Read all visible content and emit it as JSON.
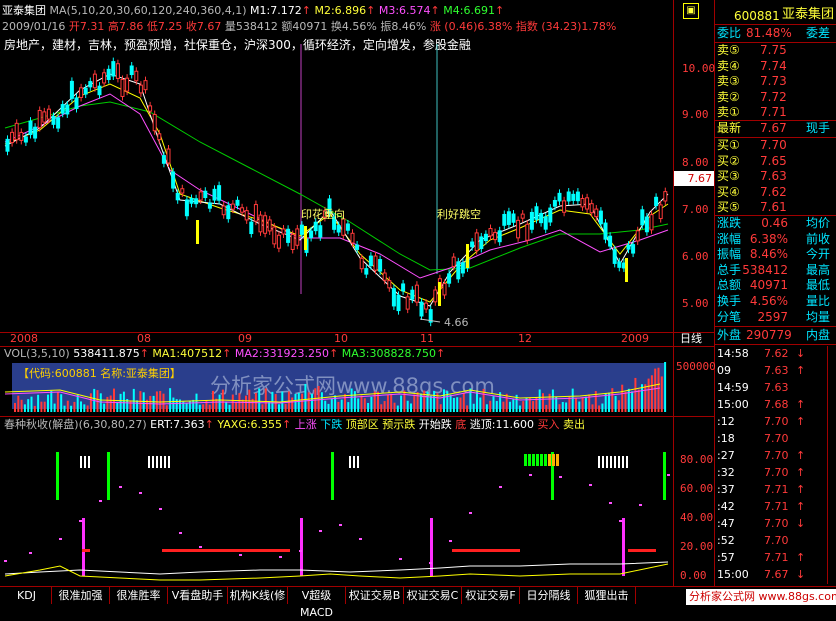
{
  "app": {
    "stock_name": "亚泰集团",
    "stock_code": "600881",
    "period_label": "日线",
    "watermark": "分析家公式网www.88gs.com",
    "footer_brand": "分析家公式网 www.88gs.com",
    "colors": {
      "up": "#ff3a3a",
      "down": "#00ffff",
      "ma5": "#ffffff",
      "ma10": "#ffff00",
      "ma20": "#ff50ff",
      "ma30": "#00ff00"
    }
  },
  "main_chart": {
    "ma_header": "MA(5,10,20,30,60,120,240,360,4,1)",
    "ma_values": [
      {
        "label": "M1:7.172",
        "arrow": "↑"
      },
      {
        "label": "M2:6.896",
        "arrow": "↑"
      },
      {
        "label": "M3:6.574",
        "arrow": "↑"
      },
      {
        "label": "M4:6.691",
        "arrow": "↑"
      }
    ],
    "info_line": {
      "date": "2009/01/16",
      "open": "开7.31",
      "high": "高7.86",
      "low": "低7.25",
      "close": "收7.67",
      "volume": "量538412",
      "amount": "额40971",
      "turnover": "换4.56%",
      "amplitude": "振8.46%",
      "change": "涨 (0.46)6.38%",
      "index": "指数 (34.23)1.78%"
    },
    "concepts": "房地产，建材，吉林，预盈预增，社保重仓，沪深300，循环经济，定向增发，参股金融",
    "price_axis": [
      "10.00",
      "9.00",
      "8.00",
      "7.00",
      "6.00",
      "5.00"
    ],
    "current_price_tag": "7.67",
    "low_marker": "4.66",
    "annotations": [
      "印花重向",
      "利好跳空"
    ],
    "time_axis": [
      "2008",
      "08",
      "09",
      "10",
      "11",
      "12",
      "2009"
    ]
  },
  "volume_chart": {
    "header": "VOL(3,5,10)",
    "values": [
      {
        "label": "538411.875",
        "arrow": "↑"
      },
      {
        "label": "MA1:407512",
        "arrow": "↑"
      },
      {
        "label": "MA2:331923.250",
        "arrow": "↑"
      },
      {
        "label": "MA3:308828.750",
        "arrow": "↑"
      }
    ],
    "code_banner": "【代码:600881 名称:亚泰集团】",
    "axis": [
      "500000"
    ]
  },
  "indicator_chart": {
    "name": "春种秋收(解盘)",
    "params": "(6,30,80,27)",
    "ert": "ERT:7.363",
    "yaxg": "YAXG:6.355",
    "items": [
      "上涨",
      "下跌",
      "顶部区",
      "预示跌",
      "开始跌",
      "底",
      "逃顶:11.600",
      "买入",
      "卖出"
    ],
    "axis": [
      "80.00",
      "60.00",
      "40.00",
      "20.00",
      "0.00"
    ]
  },
  "quote_panel": {
    "ratio": {
      "label": "委比",
      "value": "81.48%",
      "label2": "委差"
    },
    "sells": [
      {
        "label": "卖⑤",
        "price": "7.75"
      },
      {
        "label": "卖④",
        "price": "7.74"
      },
      {
        "label": "卖③",
        "price": "7.73"
      },
      {
        "label": "卖②",
        "price": "7.72"
      },
      {
        "label": "卖①",
        "price": "7.71"
      }
    ],
    "latest": {
      "label": "最新",
      "price": "7.67",
      "label2": "现手"
    },
    "buys": [
      {
        "label": "买①",
        "price": "7.70"
      },
      {
        "label": "买②",
        "price": "7.65"
      },
      {
        "label": "买③",
        "price": "7.63"
      },
      {
        "label": "买④",
        "price": "7.62"
      },
      {
        "label": "买⑤",
        "price": "7.61"
      }
    ],
    "stats": [
      {
        "l1": "涨跌",
        "v1": "0.46",
        "l2": "均价"
      },
      {
        "l1": "涨幅",
        "v1": "6.38%",
        "l2": "前收"
      },
      {
        "l1": "振幅",
        "v1": "8.46%",
        "l2": "今开"
      },
      {
        "l1": "总手",
        "v1": "538412",
        "l2": "最高"
      },
      {
        "l1": "总额",
        "v1": "40971",
        "l2": "最低"
      },
      {
        "l1": "换手",
        "v1": "4.56%",
        "l2": "量比"
      },
      {
        "l1": "分笔",
        "v1": "2597",
        "l2": "均量"
      }
    ],
    "outer": {
      "label": "外盘",
      "value": "290779",
      "label2": "内盘"
    },
    "ticks": [
      {
        "time": "14:58",
        "price": "7.62",
        "dir": "↓"
      },
      {
        "time": "09",
        "price": "7.63",
        "dir": "↑"
      },
      {
        "time": "14:59",
        "price": "7.63",
        "dir": ""
      },
      {
        "time": "15:00",
        "price": "7.68",
        "dir": "↑"
      },
      {
        "time": ":12",
        "price": "7.70",
        "dir": "↑"
      },
      {
        "time": ":18",
        "price": "7.70",
        "dir": ""
      },
      {
        "time": ":27",
        "price": "7.70",
        "dir": "↑"
      },
      {
        "time": ":32",
        "price": "7.70",
        "dir": "↑"
      },
      {
        "time": ":37",
        "price": "7.71",
        "dir": "↑"
      },
      {
        "time": ":42",
        "price": "7.71",
        "dir": "↑"
      },
      {
        "time": ":47",
        "price": "7.70",
        "dir": "↓"
      },
      {
        "time": ":52",
        "price": "7.70",
        "dir": ""
      },
      {
        "time": ":57",
        "price": "7.71",
        "dir": "↑"
      },
      {
        "time": "15:00",
        "price": "7.67",
        "dir": "↓"
      }
    ]
  },
  "tabs": [
    "KDJ",
    "很准加强",
    "很准胜率",
    "V看盘助手",
    "机构K线(修",
    "V超级MACD",
    "权证交易B",
    "权证交易C",
    "权证交易F",
    "日分隔线",
    "狐狸出击"
  ]
}
